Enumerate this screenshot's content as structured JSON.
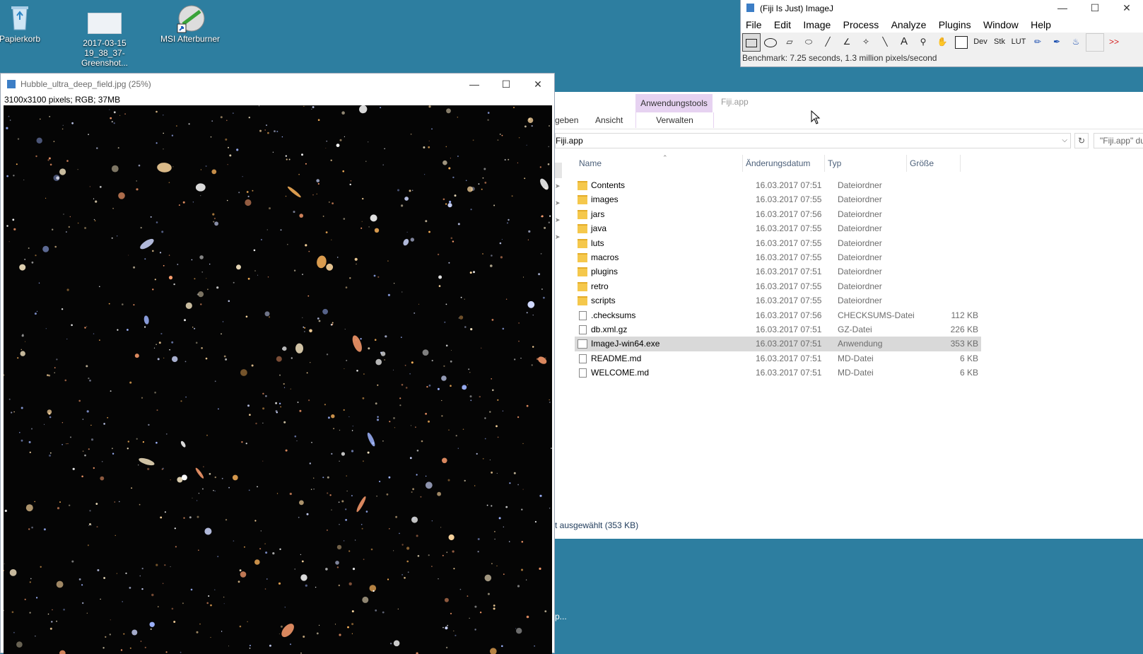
{
  "desktop": {
    "icons": [
      {
        "name": "papierkorb",
        "label": "Papierkorb"
      },
      {
        "name": "greenshot",
        "label": "2017-03-15\n19_38_37-Greenshot..."
      },
      {
        "name": "msi-afterburner",
        "label": "MSI Afterburner"
      }
    ]
  },
  "hubble": {
    "title": "Hubble_ultra_deep_field.jpg (25%)",
    "info": "3100x3100 pixels; RGB; 37MB"
  },
  "imagej": {
    "title": "(Fiji Is Just) ImageJ",
    "menus": [
      "File",
      "Edit",
      "Image",
      "Process",
      "Analyze",
      "Plugins",
      "Window",
      "Help"
    ],
    "tools": [
      "rectangle-tool",
      "oval-tool",
      "polygon-tool",
      "freehand-tool",
      "line-tool",
      "angle-tool",
      "point-tool",
      "wand-tool",
      "text-tool",
      "magnifier-tool",
      "hand-tool",
      "color-picker-tool",
      "dev-menu",
      "stk-menu",
      "lut-menu",
      "pencil-tool",
      "brush-tool",
      "flood-fill-tool",
      "blank-tool",
      "more-tools"
    ],
    "tool_labels": {
      "dev": "Dev",
      "stk": "Stk",
      "lut": "LUT",
      "text": "A",
      "more": ">>"
    },
    "status": "Benchmark: 7.25 seconds, 1.3 million pixels/second"
  },
  "explorer": {
    "context_tab": "Anwendungstools",
    "context_subtab": "Verwalten",
    "window_title": "Fiji.app",
    "tabs": [
      "geben",
      "Ansicht"
    ],
    "address": "Fiji.app",
    "search_placeholder": "\"Fiji.app\" durchsuchen",
    "columns": {
      "name": "Name",
      "date": "Änderungsdatum",
      "type": "Typ",
      "size": "Größe"
    },
    "files": [
      {
        "name": "Contents",
        "date": "16.03.2017 07:51",
        "type": "Dateiordner",
        "size": "",
        "kind": "folder"
      },
      {
        "name": "images",
        "date": "16.03.2017 07:55",
        "type": "Dateiordner",
        "size": "",
        "kind": "folder"
      },
      {
        "name": "jars",
        "date": "16.03.2017 07:56",
        "type": "Dateiordner",
        "size": "",
        "kind": "folder"
      },
      {
        "name": "java",
        "date": "16.03.2017 07:55",
        "type": "Dateiordner",
        "size": "",
        "kind": "folder"
      },
      {
        "name": "luts",
        "date": "16.03.2017 07:55",
        "type": "Dateiordner",
        "size": "",
        "kind": "folder"
      },
      {
        "name": "macros",
        "date": "16.03.2017 07:55",
        "type": "Dateiordner",
        "size": "",
        "kind": "folder"
      },
      {
        "name": "plugins",
        "date": "16.03.2017 07:51",
        "type": "Dateiordner",
        "size": "",
        "kind": "folder"
      },
      {
        "name": "retro",
        "date": "16.03.2017 07:55",
        "type": "Dateiordner",
        "size": "",
        "kind": "folder"
      },
      {
        "name": "scripts",
        "date": "16.03.2017 07:55",
        "type": "Dateiordner",
        "size": "",
        "kind": "folder"
      },
      {
        "name": ".checksums",
        "date": "16.03.2017 07:56",
        "type": "CHECKSUMS-Datei",
        "size": "112 KB",
        "kind": "file"
      },
      {
        "name": "db.xml.gz",
        "date": "16.03.2017 07:51",
        "type": "GZ-Datei",
        "size": "226 KB",
        "kind": "file"
      },
      {
        "name": "ImageJ-win64.exe",
        "date": "16.03.2017 07:51",
        "type": "Anwendung",
        "size": "353 KB",
        "kind": "exe",
        "selected": true
      },
      {
        "name": "README.md",
        "date": "16.03.2017 07:51",
        "type": "MD-Datei",
        "size": "6 KB",
        "kind": "file"
      },
      {
        "name": "WELCOME.md",
        "date": "16.03.2017 07:51",
        "type": "MD-Datei",
        "size": "6 KB",
        "kind": "file"
      }
    ],
    "status": "t ausgewählt (353 KB)",
    "fragment_label": "p..."
  },
  "colors": {
    "desktop": "#2d7ea0",
    "context_tab": "#e6d2f1",
    "selected_row": "#d9d9d9",
    "folder": "#f5c84c"
  }
}
